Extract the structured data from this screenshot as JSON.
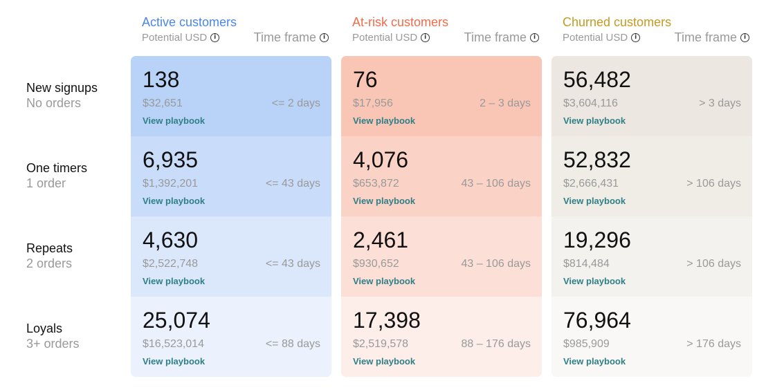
{
  "columns": [
    {
      "title": "Active customers",
      "title_color": "#4a86e8",
      "potential_label": "Potential USD",
      "timeframe_label": "Time frame",
      "colors": [
        "#b9d3f8",
        "#c9ddfa",
        "#dbe8fb",
        "#ebf2fd"
      ],
      "cells": [
        {
          "count": "138",
          "usd": "$32,651",
          "timeframe": "<= 2 days",
          "playbook": "View playbook"
        },
        {
          "count": "6,935",
          "usd": "$1,392,201",
          "timeframe": "<= 43 days",
          "playbook": "View playbook"
        },
        {
          "count": "4,630",
          "usd": "$2,522,748",
          "timeframe": "<= 43 days",
          "playbook": "View playbook"
        },
        {
          "count": "25,074",
          "usd": "$16,523,014",
          "timeframe": "<= 88 days",
          "playbook": "View playbook"
        }
      ]
    },
    {
      "title": "At-risk customers",
      "title_color": "#ef6c4a",
      "potential_label": "Potential USD",
      "timeframe_label": "Time frame",
      "colors": [
        "#f9c6b6",
        "#fbd3c6",
        "#fce0d7",
        "#fdeee9"
      ],
      "cells": [
        {
          "count": "76",
          "usd": "$17,956",
          "timeframe": "2 – 3 days",
          "playbook": "View playbook"
        },
        {
          "count": "4,076",
          "usd": "$653,872",
          "timeframe": "43 – 106 days",
          "playbook": "View playbook"
        },
        {
          "count": "2,461",
          "usd": "$930,652",
          "timeframe": "43 – 106 days",
          "playbook": "View playbook"
        },
        {
          "count": "17,398",
          "usd": "$2,519,578",
          "timeframe": "88 – 176 days",
          "playbook": "View playbook"
        }
      ]
    },
    {
      "title": "Churned customers",
      "title_color": "#c49a22",
      "potential_label": "Potential USD",
      "timeframe_label": "Time frame",
      "colors": [
        "#ece8e1",
        "#f0ede7",
        "#f4f2ee",
        "#f9f8f6"
      ],
      "cells": [
        {
          "count": "56,482",
          "usd": "$3,604,116",
          "timeframe": "> 3 days",
          "playbook": "View playbook"
        },
        {
          "count": "52,832",
          "usd": "$2,666,431",
          "timeframe": "> 106 days",
          "playbook": "View playbook"
        },
        {
          "count": "19,296",
          "usd": "$814,484",
          "timeframe": "> 106 days",
          "playbook": "View playbook"
        },
        {
          "count": "76,964",
          "usd": "$985,909",
          "timeframe": "> 176 days",
          "playbook": "View playbook"
        }
      ]
    }
  ],
  "rows": [
    {
      "label": "New signups",
      "sublabel": "No orders"
    },
    {
      "label": "One timers",
      "sublabel": "1 order"
    },
    {
      "label": "Repeats",
      "sublabel": "2 orders"
    },
    {
      "label": "Loyals",
      "sublabel": "3+ orders"
    }
  ],
  "info_icon": "info-icon"
}
